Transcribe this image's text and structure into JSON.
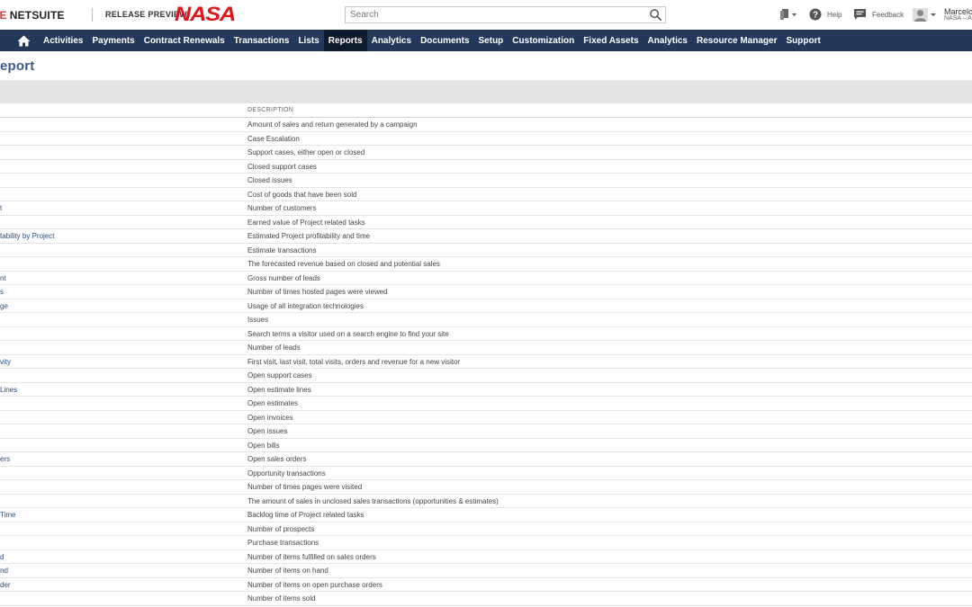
{
  "header": {
    "logo_oracle": "LE",
    "logo_netsuite": "NETSUITE",
    "release_preview": "RELEASE PREVIEW",
    "account_logo": "NASA",
    "search_placeholder": "Search",
    "help_label": "Help",
    "feedback_label": "Feedback",
    "user_name": "Marcelo",
    "user_account": "NASA – A"
  },
  "nav": {
    "items": [
      {
        "label": "Activities"
      },
      {
        "label": "Payments"
      },
      {
        "label": "Contract Renewals"
      },
      {
        "label": "Transactions"
      },
      {
        "label": "Lists"
      },
      {
        "label": "Reports",
        "active": true
      },
      {
        "label": "Analytics"
      },
      {
        "label": "Documents"
      },
      {
        "label": "Setup"
      },
      {
        "label": "Customization"
      },
      {
        "label": "Fixed Assets"
      },
      {
        "label": "Analytics"
      },
      {
        "label": "Resource Manager"
      },
      {
        "label": "Support"
      }
    ]
  },
  "page": {
    "title": "eport"
  },
  "table": {
    "description_header": "DESCRIPTION",
    "rows": [
      {
        "name": "",
        "description": "Amount of sales and return generated by a campaign"
      },
      {
        "name": "",
        "description": "Case Escalation"
      },
      {
        "name": "",
        "description": "Support cases, either open or closed"
      },
      {
        "name": "",
        "description": "Closed support cases"
      },
      {
        "name": "",
        "description": "Closed issues"
      },
      {
        "name": "",
        "description": "Cost of goods that have been sold"
      },
      {
        "name": "t",
        "description": "Number of customers"
      },
      {
        "name": "",
        "description": "Earned value of Project related tasks"
      },
      {
        "name": "tability by Project",
        "description": "Estimated Project profitability and time"
      },
      {
        "name": "",
        "description": "Estimate transactions"
      },
      {
        "name": "",
        "description": "The forecasted revenue based on closed and potential sales"
      },
      {
        "name": "nt",
        "description": "Gross number of leads"
      },
      {
        "name": "s",
        "description": "Number of times hosted pages were viewed"
      },
      {
        "name": "ge",
        "description": "Usage of all integration technologies"
      },
      {
        "name": "",
        "description": "Issues"
      },
      {
        "name": "",
        "description": "Search terms a visitor used on a search engine to find your site"
      },
      {
        "name": "",
        "description": "Number of leads"
      },
      {
        "name": "vity",
        "description": "First visit, last visit, total visits, orders and revenue for a new visitor"
      },
      {
        "name": "",
        "description": "Open support cases"
      },
      {
        "name": "Lines",
        "description": "Open estimate lines"
      },
      {
        "name": "",
        "description": "Open estimates"
      },
      {
        "name": "",
        "description": "Open invoices"
      },
      {
        "name": "",
        "description": "Open issues"
      },
      {
        "name": "",
        "description": "Open bills"
      },
      {
        "name": "ers",
        "description": "Open sales orders"
      },
      {
        "name": "",
        "description": "Opportunity transactions"
      },
      {
        "name": "",
        "description": "Number of times pages were visited"
      },
      {
        "name": "",
        "description": "The amount of sales in unclosed sales transactions (opportunities & estimates)"
      },
      {
        "name": "Time",
        "description": "Backlog time of Project related tasks"
      },
      {
        "name": "",
        "description": "Number of prospects"
      },
      {
        "name": "",
        "description": "Purchase transactions"
      },
      {
        "name": "d",
        "description": "Number of items fulfilled on sales orders"
      },
      {
        "name": "nd",
        "description": "Number of items on hand"
      },
      {
        "name": "der",
        "description": "Number of items on open purchase orders"
      },
      {
        "name": "",
        "description": "Number of items sold"
      }
    ]
  },
  "colors": {
    "nav_bg": "#24385b",
    "nav_active": "#0e1b2e",
    "link": "#1f4e8c",
    "title": "#3b5b8a",
    "brand_red": "#c74634"
  }
}
